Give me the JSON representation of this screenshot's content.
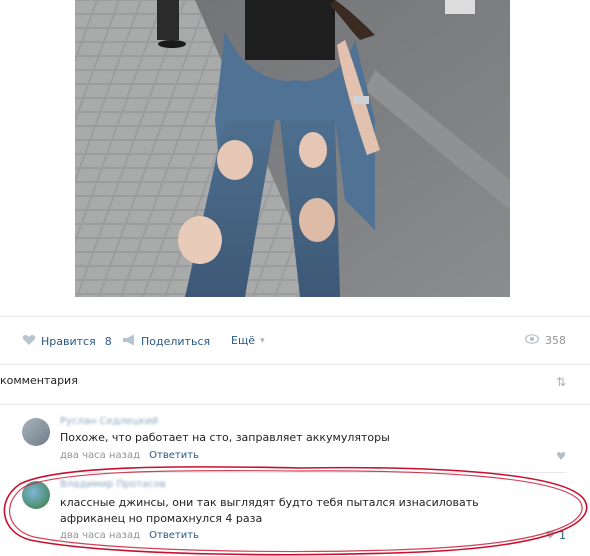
{
  "post": {
    "actions": {
      "like_label": "Нравится",
      "like_count": "8",
      "share_label": "Поделиться",
      "more_label": "Ещё"
    },
    "views": "358"
  },
  "comments": {
    "header": "комментария",
    "items": [
      {
        "text": "Похоже, что работает на сто, заправляет аккумуляторы",
        "time": "два часа назад",
        "reply": "Ответить"
      },
      {
        "text": "классные джинсы, они так выглядят будто тебя пытался изнасиловать африканец но промахнулся 4 раза",
        "time": "два часа назад",
        "reply": "Ответить",
        "likes": "1"
      }
    ]
  },
  "colors": {
    "link": "#2a5885",
    "muted": "#939393",
    "highlight_stroke": "#c8102e"
  }
}
